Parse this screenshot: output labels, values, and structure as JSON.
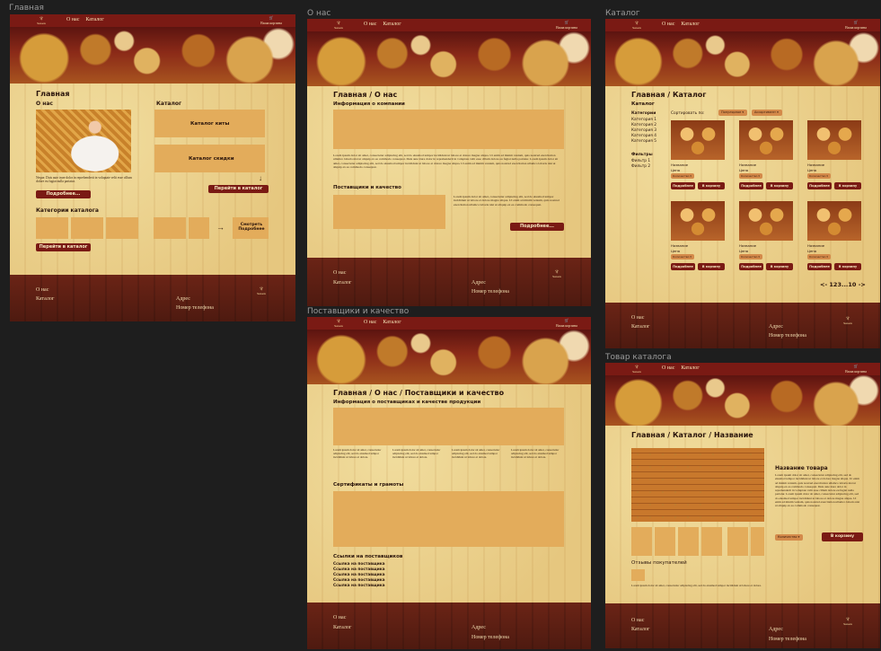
{
  "frames": {
    "home": "Главная",
    "about": "О нас",
    "catalog": "Каталог",
    "suppliers": "Поставщики и качество",
    "product": "Товар каталога"
  },
  "nav": {
    "about": "О нас",
    "catalog": "Каталог",
    "basket": "Ваша корзина"
  },
  "lorem_short": "Neque. Duis aute irure dolor in reprehenderit in voluptate velit esse cillum dolore eu fugiat nulla pariatur.",
  "lorem_long": "Lorem ipsum dolor sit amet, consectetur adipiscing elit, sed do eiusmod tempor incididunt ut labore et dolore magna aliqua. Ut enim ad minim veniam, quis nostrud exercitation ullamco laboris nisi ut aliquip ex ea commodo consequat. Duis aute irure dolor in reprehenderit in voluptate velit esse cillum dolore eu fugiat nulla pariatur. Lorem ipsum dolor sit amet, consectetur adipiscing elit, sed do eiusmod tempor incididunt ut labore et dolore magna aliqua. Ut enim ad minim veniam, quis nostrud exercitation ullamco laboris nisi ut aliquip ex ea commodo consequat.",
  "lorem_mid": "Lorem ipsum dolor sit amet, consectetur adipiscing elit, sed do eiusmod tempor incididunt ut labore et dolore magna aliqua. Ut enim ad minim veniam, quis nostrud exercitation ullamco laboris nisi ut aliquip ex ea commodo consequat.",
  "lorem_card": "Lorem ipsum dolor sit amet, consectetur adipiscing elit, sed do eiusmod tempor incididunt ut labore et dolore.",
  "footer": {
    "about": "О нас",
    "catalog": "Каталог",
    "address": "Адрес",
    "phone": "Номер телефона"
  },
  "home": {
    "title": "Главная",
    "about_head": "О нас",
    "more_btn": "Подробнее...",
    "catalog_head": "Каталог",
    "catalog_kits": "Каталог киты",
    "catalog_sale": "Каталог скидки",
    "arrow_down": "↓",
    "goto_catalog": "Перейти в каталог",
    "categories_head": "Категории каталога",
    "arrow_right": "→",
    "see_more": "Смотреть Подробнее",
    "goto_catalog2": "Перейти в каталог"
  },
  "about": {
    "title": "Главная / О нас",
    "info_head": "Информация о компании",
    "suppliers_head": "Поставщики и качество",
    "more_btn": "Подробнее..."
  },
  "suppliers": {
    "title": "Главная / О нас / Поставщики и качество",
    "info_head": "Информация о поставщиках и качестве продукции",
    "certs_head": "Сертификаты и грамоты",
    "links_head": "Ссылки на поставщиков",
    "links": [
      "Ссылка на поставщика",
      "Ссылка на поставщика",
      "Ссылка на поставщика",
      "Ссылка на поставщика",
      "Ссылка на поставщика"
    ]
  },
  "catalog": {
    "title": "Главная / Каталог",
    "side_head": "Каталог",
    "cats_head": "Категории",
    "cats": [
      "Категория 1",
      "Категория 2",
      "Категория 3",
      "Категория 4",
      "Категория 5"
    ],
    "filters_head": "Фильтры",
    "filters": [
      "Фильтр 1",
      "Фильтр 2"
    ],
    "sort_label": "Сортировать по:",
    "sort_a": "Популярное",
    "sort_b": "Ассортимент",
    "card_name": "Название",
    "card_price": "Цена",
    "card_qty": "Количество",
    "card_more": "Подробнее",
    "card_cart": "В корзину",
    "pager": "<- 123...10 ->"
  },
  "product": {
    "title": "Главная / Каталог / Название",
    "name": "Название товара",
    "qty": "Количество",
    "cart": "В корзину",
    "reviews_head": "Отзывы покупателей"
  }
}
